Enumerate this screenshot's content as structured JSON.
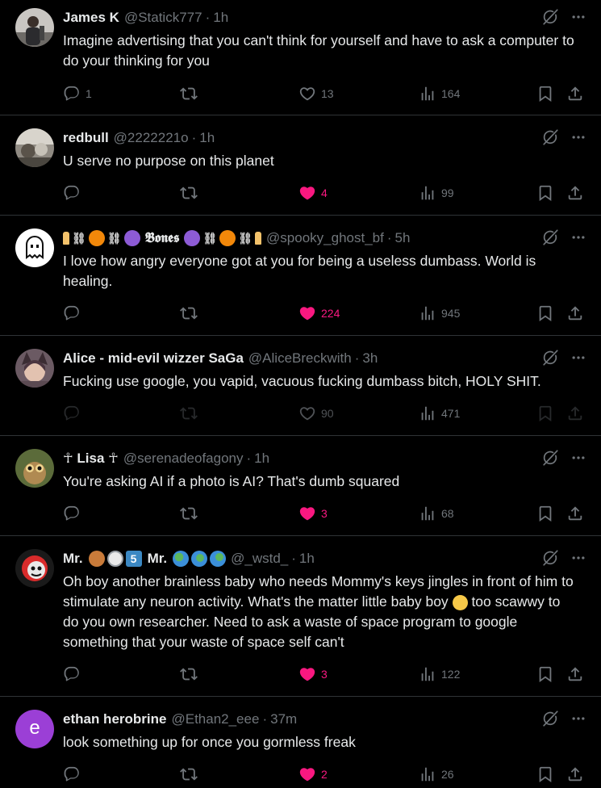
{
  "colors": {
    "background": "#000000",
    "text": "#e7e9ea",
    "secondary": "#71767b",
    "divider": "#2f3336",
    "like_active": "#f91880"
  },
  "tweets": [
    {
      "name": "James K",
      "handle": "@Statick777",
      "sep": "·",
      "time": "1h",
      "text": "Imagine advertising that you can't think for yourself and have to ask a computer to do your thinking for you",
      "replies": "1",
      "retweets": "",
      "likes": "13",
      "liked": false,
      "views": "164"
    },
    {
      "name": "redbull",
      "handle": "@2222221o",
      "sep": "·",
      "time": "1h",
      "text": "U serve no purpose on this planet",
      "replies": "",
      "retweets": "",
      "likes": "4",
      "liked": true,
      "views": "99"
    },
    {
      "name": "🕯️⛓️🎃⛓️🔮 𝕭𝖔𝖓𝖊𝖘 🔮⛓️🎃⛓️🕯️",
      "name_display": "𝕭𝖔𝖓𝖊𝖘",
      "handle": "@spooky_ghost_bf",
      "sep": "·",
      "time": "5h",
      "text": "I love how angry everyone got at you for being a useless dumbass. World is healing.",
      "replies": "",
      "retweets": "",
      "likes": "224",
      "liked": true,
      "views": "945"
    },
    {
      "name": "Alice - mid-evil wizzer SaGa",
      "handle": "@AliceBreckwith",
      "sep": "·",
      "time": "3h",
      "text": "Fucking use google, you vapid, vacuous fucking dumbass bitch, HOLY SHIT.",
      "replies": "",
      "retweets": "",
      "likes": "90",
      "liked": false,
      "views": "471"
    },
    {
      "name": "☥ Lisa ☥",
      "handle": "@serenadeofagony",
      "sep": "·",
      "time": "1h",
      "text": "You're asking AI if a photo is AI? That's dumb squared",
      "replies": "",
      "retweets": "",
      "likes": "3",
      "liked": true,
      "views": "68"
    },
    {
      "name": "Mr. 🥉🕐5️⃣ Mr. 🌎🌍🌏",
      "name_a": "Mr.",
      "name_b": "Mr.",
      "badge_num": "5",
      "handle": "@_wstd_",
      "sep": "·",
      "time": "1h",
      "text": "Oh boy another brainless baby who needs Mommy's keys jingles in front of him to stimulate any neuron activity. What's the matter little baby boy 🥺 too scawwy to do you own researcher. Need to ask a waste of space program to google something that your waste of space self can't",
      "text_a": "Oh boy another brainless baby who needs Mommy's keys jingles in front of him to stimulate any neuron activity. What's the matter little baby boy",
      "text_b": "too scawwy to do you own researcher. Need to ask a waste of space program to google something that your waste of space self can't",
      "replies": "",
      "retweets": "",
      "likes": "3",
      "liked": true,
      "views": "122"
    },
    {
      "name": "ethan herobrine",
      "avatar_letter": "e",
      "avatar_color": "#9b3fd6",
      "handle": "@Ethan2_eee",
      "sep": "·",
      "time": "37m",
      "text": "look something up for once you gormless freak",
      "replies": "",
      "retweets": "",
      "likes": "2",
      "liked": true,
      "views": "26"
    }
  ]
}
